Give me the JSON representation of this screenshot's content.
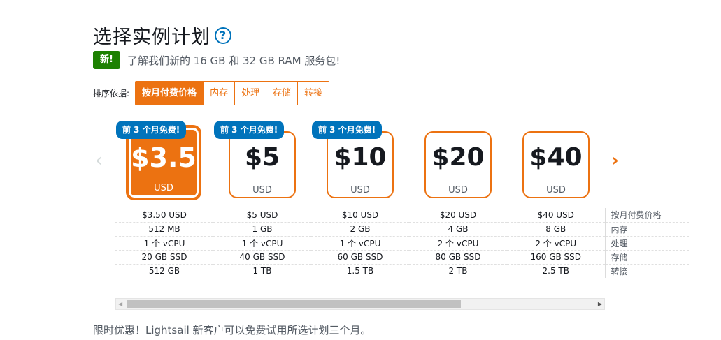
{
  "title": "选择实例计划",
  "help_icon": "help-circle-icon",
  "new_badge": "新!",
  "new_text": "了解我们新的 16 GB 和 32 GB RAM 服务包!",
  "sort": {
    "label": "排序依据:",
    "options": [
      "按月付费价格",
      "内存",
      "处理",
      "存储",
      "转接"
    ],
    "selected": "按月付费价格"
  },
  "plans": [
    {
      "price": "$3.5",
      "currency": "USD",
      "promo": "前 3 个月免费!",
      "selected": true
    },
    {
      "price": "$5",
      "currency": "USD",
      "promo": "前 3 个月免费!",
      "selected": false
    },
    {
      "price": "$10",
      "currency": "USD",
      "promo": "前 3 个月免费!",
      "selected": false
    },
    {
      "price": "$20",
      "currency": "USD",
      "promo": "",
      "selected": false
    },
    {
      "price": "$40",
      "currency": "USD",
      "promo": "",
      "selected": false
    }
  ],
  "spec_rows": [
    {
      "label": "按月付费价格",
      "values": [
        "$3.50 USD",
        "$5 USD",
        "$10 USD",
        "$20 USD",
        "$40 USD"
      ]
    },
    {
      "label": "内存",
      "values": [
        "512 MB",
        "1 GB",
        "2 GB",
        "4 GB",
        "8 GB"
      ]
    },
    {
      "label": "处理",
      "values": [
        "1 个 vCPU",
        "1 个 vCPU",
        "1 个 vCPU",
        "2 个 vCPU",
        "2 个 vCPU"
      ]
    },
    {
      "label": "存储",
      "values": [
        "20 GB SSD",
        "40 GB SSD",
        "60 GB SSD",
        "80 GB SSD",
        "160 GB SSD"
      ]
    },
    {
      "label": "转接",
      "values": [
        "512 GB",
        "1 TB",
        "1.5 TB",
        "2 TB",
        "2.5 TB"
      ]
    }
  ],
  "carousel": {
    "prev_icon": "chevron-left-icon",
    "next_icon": "chevron-right-icon"
  },
  "footer_text": "限时优惠！Lightsail 新客户可以免费试用所选计划三个月。",
  "colors": {
    "accent": "#ec7211",
    "promo": "#0073bb",
    "new": "#1d8102"
  }
}
